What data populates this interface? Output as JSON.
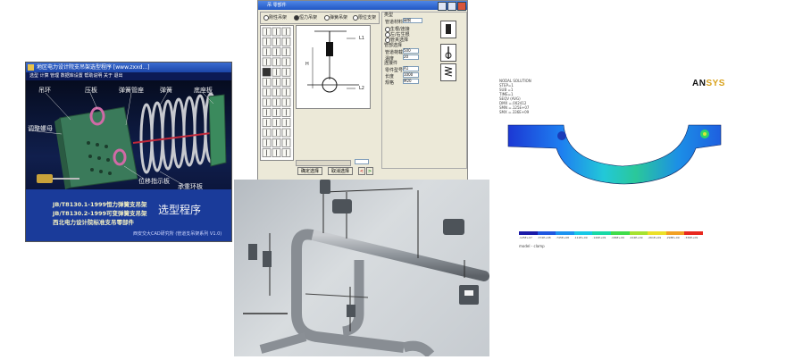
{
  "window1": {
    "title": "地区电力设计院支吊架选型程序 [www.zxxd...]",
    "menu": "选型 计算 管理 数据库设置 帮助说明 关于 退出",
    "callouts": {
      "a": "吊环",
      "b": "压板",
      "c": "弹簧管座",
      "d": "弹簧",
      "e": "底座板",
      "f": "调整螺母",
      "g": "位移指示板",
      "h": "承重环板"
    },
    "standard_line1": "JB/T8130.1-1999恒力弹簧支吊架",
    "standard_line2": "JB/T8130.2-1999可变弹簧支吊架",
    "standard_line3": "西北电力设计院标准支吊零部件",
    "program_title": "选型程序",
    "footer": "西安交大CAD研究所 (管道支吊架系列 V1.0)"
  },
  "window2": {
    "title": "吊 零部件",
    "tab_labels": [
      "刚性吊架",
      "恒力吊架",
      "弹簧吊架",
      "限位支架"
    ],
    "right_panel": {
      "header": "类型",
      "type_label": "管道材料",
      "type_value": "碳钢",
      "options": [
        "生根/连接",
        "左/右生根",
        "管夹选择"
      ],
      "section2": "管部选择",
      "load_label": "管道荷载",
      "load_value": "500",
      "temp_label": "温度",
      "temp_value": "20",
      "section3": "连接件",
      "part_label": "零件型号",
      "part_value": "A1",
      "len_label": "长度",
      "len_value": "1000",
      "spec_label": "规格",
      "spec_value": "M20"
    },
    "canvas_labels": {
      "top": "L1",
      "mid": "H",
      "bottom": "L2"
    },
    "buttons": {
      "ok": "确定选择",
      "cancel": "取消选择"
    },
    "nav": [
      "<",
      ">"
    ]
  },
  "window4": {
    "logo_prefix": "AN",
    "logo_suffix": "SYS",
    "header_lines": [
      "NODAL SOLUTION",
      "STEP=1",
      "SUB =1",
      "TIME=1",
      "SEQV (AVG)",
      "DMX =.002412",
      "SMN =.125E+07",
      "SMX =.336E+09"
    ],
    "legend_colors": [
      "#1a1aa8",
      "#1f57e0",
      "#1c93f0",
      "#18c8e6",
      "#19d9a6",
      "#3fdc4a",
      "#a6e230",
      "#ece028",
      "#f2a022",
      "#e8281e"
    ],
    "legend_values": [
      ".125E+07",
      ".372E+08",
      ".745E+08",
      ".112E+09",
      ".149E+09",
      ".186E+09",
      ".224E+09",
      ".261E+09",
      ".298E+09",
      ".336E+09"
    ],
    "legend_caption": "model - clamp"
  }
}
